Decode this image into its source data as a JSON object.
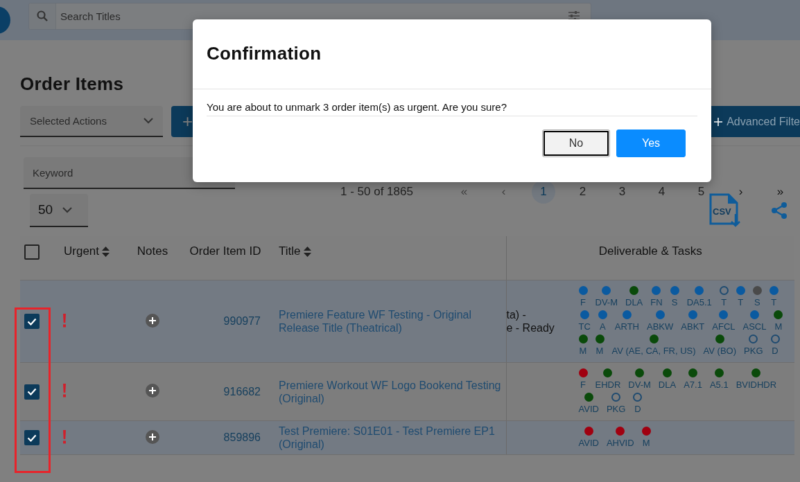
{
  "top_bar": {
    "search": {
      "placeholder": "Search Titles"
    }
  },
  "page": {
    "title": "Order Items",
    "actions": {
      "dropdown": "Selected Actions",
      "add_button": "+",
      "advanced_filters": "Advanced Filte"
    },
    "keyword": {
      "placeholder": "Keyword"
    },
    "pagination": {
      "range": "1 - 50 of 1865",
      "first": "«",
      "prev": "‹",
      "next": "›",
      "last": "»",
      "pages": [
        {
          "label": "1",
          "selected": true
        },
        {
          "label": "2",
          "selected": false
        },
        {
          "label": "3",
          "selected": false
        },
        {
          "label": "4",
          "selected": false
        },
        {
          "label": "5",
          "selected": false
        }
      ]
    },
    "page_size": "50",
    "export_label": "CSV"
  },
  "table": {
    "columns": [
      {
        "label": "Urgent",
        "sortable": true
      },
      {
        "label": "Notes",
        "sortable": false
      },
      {
        "label": "Order Item ID",
        "sortable": false
      },
      {
        "label": "Title",
        "sortable": true
      },
      {
        "label": "Deliverable & Tasks",
        "sortable": false
      }
    ],
    "select_all": {
      "checked": false
    },
    "rows": [
      {
        "checked": true,
        "urgent": true,
        "id": "990977",
        "title": "Premiere Feature WF Testing - Original Release Title (Theatrical)",
        "column_5": [
          "ta) -",
          "e - Ready"
        ],
        "deliverables": [
          {
            "label": "F",
            "kind": "dot",
            "color": "#0a5aa0"
          },
          {
            "label": "DV-M",
            "kind": "dot",
            "color": "#0a5aa0"
          },
          {
            "label": "DLA",
            "kind": "dot",
            "color": "#0a4a0a"
          },
          {
            "label": "FN",
            "kind": "dot",
            "color": "#0a5aa0"
          },
          {
            "label": "S",
            "kind": "dot",
            "color": "#0a5aa0"
          },
          {
            "label": "DA5.1",
            "kind": "dot",
            "color": "#0a5aa0"
          },
          {
            "label": "T",
            "kind": "ring",
            "color": "#1f4b70"
          },
          {
            "label": "T",
            "kind": "dot",
            "color": "#0a5aa0"
          },
          {
            "label": "S",
            "kind": "dot",
            "color": "#4a4a4a"
          },
          {
            "label": "T",
            "kind": "dot",
            "color": "#0a5aa0"
          },
          {
            "label": "TC",
            "kind": "dot",
            "color": "#0a5aa0"
          },
          {
            "label": "A",
            "kind": "dot",
            "color": "#0a5aa0"
          },
          {
            "label": "ARTH",
            "kind": "dot",
            "color": "#0a5aa0"
          },
          {
            "label": "ABKW",
            "kind": "dot",
            "color": "#0a5aa0"
          },
          {
            "label": "ABKT",
            "kind": "dot",
            "color": "#0a5aa0"
          },
          {
            "label": "AFCL",
            "kind": "dot",
            "color": "#0a5aa0"
          },
          {
            "label": "ASCL",
            "kind": "dot",
            "color": "#0a5aa0"
          },
          {
            "label": "M",
            "kind": "dot",
            "color": "#0a4a0a"
          },
          {
            "label": "M",
            "kind": "dot",
            "color": "#0a4a0a"
          },
          {
            "label": "M",
            "kind": "dot",
            "color": "#0a4a0a"
          },
          {
            "label": "AV (AE, CA, FR, US)",
            "kind": "dot",
            "color": "#0a4a0a"
          },
          {
            "label": "AV (BO)",
            "kind": "dot",
            "color": "#0a4a0a"
          },
          {
            "label": "PKG",
            "kind": "ring",
            "color": "#1f4b70"
          },
          {
            "label": "D",
            "kind": "ring",
            "color": "#1f4b70"
          }
        ]
      },
      {
        "checked": true,
        "urgent": true,
        "id": "916682",
        "title": "Premiere Workout WF Logo Bookend Testing (Original)",
        "deliverables": [
          {
            "label": "F",
            "kind": "dot",
            "color": "#a00010"
          },
          {
            "label": "EHDR",
            "kind": "dot",
            "color": "#0a4a0a"
          },
          {
            "label": "DV-M",
            "kind": "dot",
            "color": "#0a4a0a"
          },
          {
            "label": "DLA",
            "kind": "dot",
            "color": "#0a4a0a"
          },
          {
            "label": "A7.1",
            "kind": "dot",
            "color": "#0a4a0a"
          },
          {
            "label": "A5.1",
            "kind": "dot",
            "color": "#0a4a0a"
          },
          {
            "label": "BVIDHDR",
            "kind": "dot",
            "color": "#0a4a0a"
          },
          {
            "label": "AVID",
            "kind": "dot",
            "color": "#0a4a0a"
          },
          {
            "label": "PKG",
            "kind": "ring",
            "color": "#1f4b70"
          },
          {
            "label": "D",
            "kind": "ring",
            "color": "#1f4b70"
          }
        ]
      },
      {
        "checked": true,
        "urgent": true,
        "id": "859896",
        "title": "Test Premiere: S01E01 - Test Premiere EP1 (Original)",
        "deliverables": [
          {
            "label": "AVID",
            "kind": "dot",
            "color": "#a00010"
          },
          {
            "label": "AHVID",
            "kind": "dot",
            "color": "#a00010"
          },
          {
            "label": "M",
            "kind": "dot",
            "color": "#a00010"
          }
        ]
      }
    ]
  },
  "annotation": {
    "color": "#e8232a"
  },
  "dialog": {
    "title": "Confirmation",
    "message": "You are about to unmark 3 order item(s) as urgent. Are you sure?",
    "buttons": [
      {
        "label": "No",
        "kind": "secondary",
        "focused": true
      },
      {
        "label": "Yes",
        "kind": "primary",
        "focused": false
      }
    ]
  }
}
